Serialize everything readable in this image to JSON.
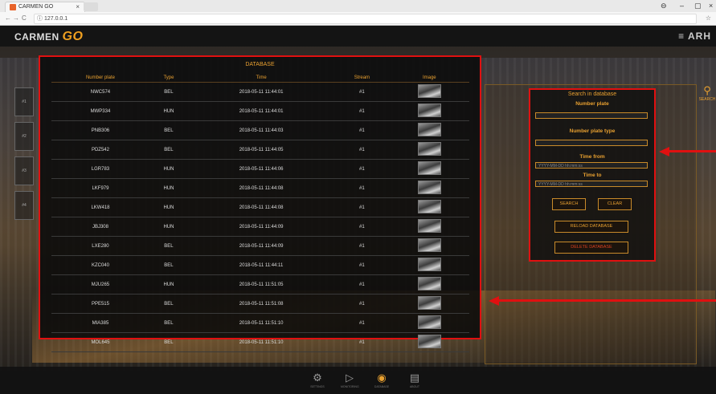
{
  "browser": {
    "tab_title": "CARMEN GO",
    "tab_close": "×",
    "url": "127.0.0.1",
    "nav_back": "←",
    "nav_forward": "→",
    "nav_reload": "C",
    "secure_icon": "ⓘ",
    "bookmark_icon": "☆",
    "account_icon": "⊖",
    "minimize": "–",
    "maximize": "▢",
    "close": "×"
  },
  "app": {
    "logo_text": "CARMEN",
    "logo_suffix": "GO",
    "brand": "ARH"
  },
  "stream_tiles": [
    "#1",
    "#2",
    "#3",
    "#4"
  ],
  "database": {
    "title": "DATABASE",
    "columns": [
      "Number plate",
      "Type",
      "Time",
      "Stream",
      "Image"
    ],
    "rows": [
      [
        "NWC574",
        "BEL",
        "2018-05-11 11:44:01",
        "#1"
      ],
      [
        "MWP334",
        "HUN",
        "2018-05-11 11:44:01",
        "#1"
      ],
      [
        "PNB306",
        "BEL",
        "2018-05-11 11:44:03",
        "#1"
      ],
      [
        "PDZ542",
        "BEL",
        "2018-05-11 11:44:05",
        "#1"
      ],
      [
        "LGR783",
        "HUN",
        "2018-05-11 11:44:06",
        "#1"
      ],
      [
        "LKF979",
        "HUN",
        "2018-05-11 11:44:08",
        "#1"
      ],
      [
        "LKW418",
        "HUN",
        "2018-05-11 11:44:08",
        "#1"
      ],
      [
        "JBJ308",
        "HUN",
        "2018-05-11 11:44:09",
        "#1"
      ],
      [
        "LXE280",
        "BEL",
        "2018-05-11 11:44:09",
        "#1"
      ],
      [
        "KZC040",
        "BEL",
        "2018-05-11 11:44:11",
        "#1"
      ],
      [
        "MJU265",
        "HUN",
        "2018-05-11 11:51:05",
        "#1"
      ],
      [
        "PPE515",
        "BEL",
        "2018-05-11 11:51:08",
        "#1"
      ],
      [
        "MIA385",
        "BEL",
        "2018-05-11 11:51:10",
        "#1"
      ],
      [
        "MOL645",
        "BEL",
        "2018-05-11 11:51:10",
        "#1"
      ]
    ]
  },
  "search": {
    "title": "Search in database",
    "plate_label": "Number plate",
    "plate_value": "",
    "type_label": "Number plate type",
    "type_value": "",
    "time_from_label": "Time from",
    "time_from_placeholder": "YYYY-MM-DD hh:mm:ss",
    "time_to_label": "Time to",
    "time_to_placeholder": "YYYY-MM-DD hh:mm:ss",
    "search_btn": "SEARCH",
    "clear_btn": "CLEAR",
    "reload_btn": "RELOAD DATABASE",
    "delete_btn": "DELETE DATABASE",
    "side_tab_label": "SEARCH"
  },
  "bottom_nav": [
    {
      "icon": "settings-icon",
      "label": "SETTINGS"
    },
    {
      "icon": "play-icon",
      "label": "MONITORING"
    },
    {
      "icon": "database-icon",
      "label": "DATABASE"
    },
    {
      "icon": "document-icon",
      "label": "ABOUT"
    }
  ],
  "colors": {
    "accent": "#e8a030",
    "highlight": "#e01010",
    "panel": "#0a0a0a"
  }
}
